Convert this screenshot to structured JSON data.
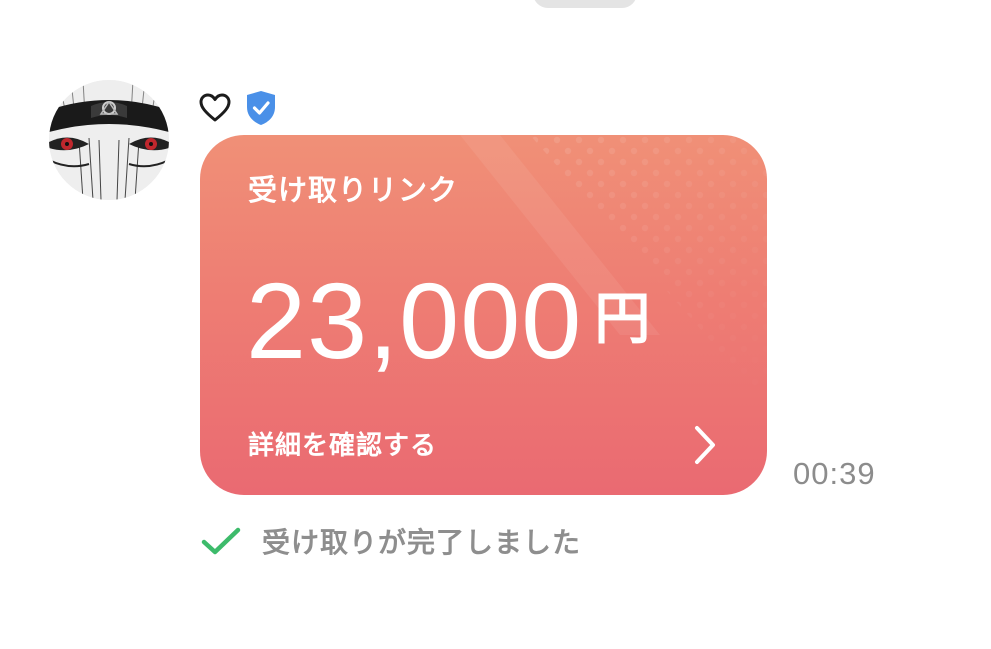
{
  "card": {
    "title": "受け取りリンク",
    "amount": "23,000",
    "currency": "円",
    "detail_label": "詳細を確認する",
    "chevron_icon": "chevron-right-icon",
    "gradient_top": "#f09077",
    "gradient_bottom": "#ea6a72"
  },
  "message": {
    "time": "00:39",
    "reaction_icon": "heart-outline-icon",
    "verified_icon": "verified-shield-icon",
    "verified_color": "#4a90e8"
  },
  "status": {
    "text": "受け取りが完了しました",
    "icon": "checkmark-icon",
    "icon_color": "#3dbb6b"
  }
}
